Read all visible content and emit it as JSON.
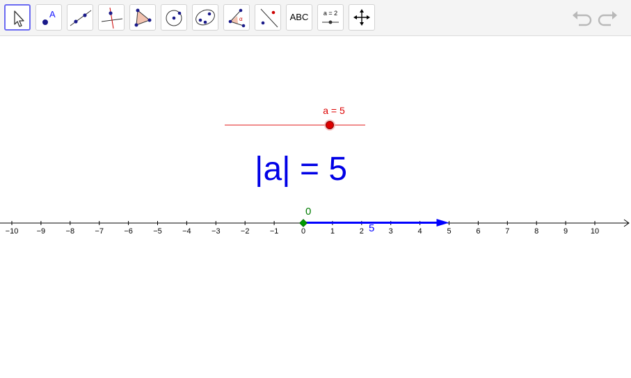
{
  "toolbar": {
    "tools": [
      {
        "name": "move-tool",
        "icon": "cursor-arrow-icon"
      },
      {
        "name": "point-tool",
        "icon": "point-icon",
        "glyph": "A"
      },
      {
        "name": "line-tool",
        "icon": "line-through-points-icon"
      },
      {
        "name": "perpendicular-line-tool",
        "icon": "perpendicular-line-icon"
      },
      {
        "name": "polygon-tool",
        "icon": "polygon-icon"
      },
      {
        "name": "circle-tool",
        "icon": "circle-center-point-icon"
      },
      {
        "name": "conic-tool",
        "icon": "ellipse-icon"
      },
      {
        "name": "angle-tool",
        "icon": "angle-icon",
        "glyph": "α"
      },
      {
        "name": "reflect-tool",
        "icon": "reflect-about-line-icon"
      },
      {
        "name": "text-tool",
        "icon": "text-icon",
        "label": "ABC"
      },
      {
        "name": "slider-tool",
        "icon": "slider-icon",
        "label": "a = 2"
      },
      {
        "name": "move-graphics-view-tool",
        "icon": "move-arrows-icon"
      }
    ],
    "undo_icon": "undo-icon",
    "redo_icon": "redo-icon"
  },
  "slider": {
    "name": "a",
    "value": 5,
    "min": -5,
    "max": 5,
    "label": "a = 5",
    "color": "#dd0000"
  },
  "abs_text": "|a| = 5",
  "number_line": {
    "min": -10,
    "max": 10,
    "tick_labels": [
      "−10",
      "−9",
      "−8",
      "−7",
      "−6",
      "−5",
      "−4",
      "−3",
      "−2",
      "−1",
      "0",
      "1",
      "2",
      "3",
      "4",
      "5",
      "6",
      "7",
      "8",
      "9",
      "10"
    ]
  },
  "origin_point": {
    "label": "0",
    "value": 0,
    "color": "#009900"
  },
  "vector": {
    "from": 0,
    "to": 5,
    "label": "5",
    "color": "#0000ff"
  },
  "colors": {
    "accent": "#6a6af2",
    "text_blue": "#0000e6"
  }
}
